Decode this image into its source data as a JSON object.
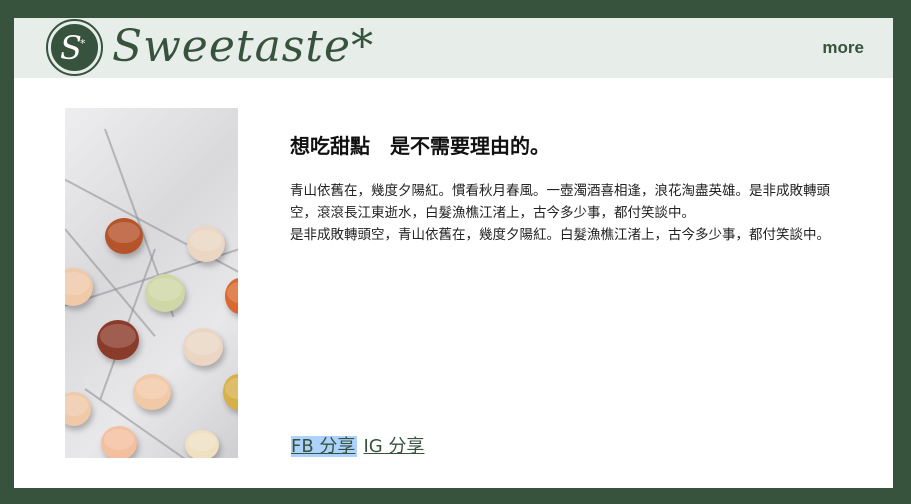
{
  "header": {
    "brand": "Sweetaste",
    "brand_star": "*",
    "logo_letter": "S",
    "logo_star": "*",
    "more_label": "more"
  },
  "main": {
    "title": "想吃甜點　是不需要理由的。",
    "paragraphs": [
      "青山依舊在，幾度夕陽紅。慣看秋月春風。一壺濁酒喜相逢，浪花淘盡英雄。是非成敗轉頭空，滾滾長江東逝水，白髮漁樵江渚上，古今多少事，都付笑談中。",
      "是非成敗轉頭空，青山依舊在，幾度夕陽紅。白髮漁樵江渚上，古今多少事，都付笑談中。"
    ],
    "share": {
      "fb_label": "FB 分享",
      "ig_label": "IG 分享"
    }
  },
  "colors": {
    "background": "#37523d",
    "header_bg": "#e7eeea",
    "highlight": "#acd2fe"
  },
  "image": {
    "subject": "macarons-on-marble-photo"
  }
}
